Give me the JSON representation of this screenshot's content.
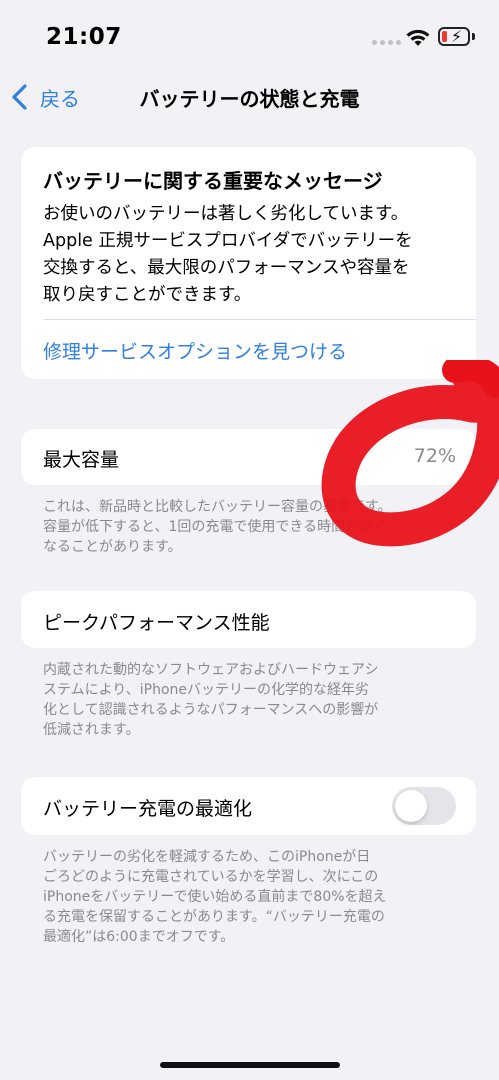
{
  "status_bar": {
    "time": "21:07",
    "battery_level": "low",
    "charging": true,
    "battery_color": "#eb3b30"
  },
  "nav": {
    "back_label": "戻る",
    "title": "バッテリーの状態と充電"
  },
  "message_card": {
    "title": "バッテリーに関する重要なメッセージ",
    "body_lines": [
      "お使いのバッテリーは著しく劣化しています。",
      "Apple 正規サービスプロバイダでバッテリーを",
      "交換すると、最大限のパフォーマンスや容量を",
      "取り戻すことができます。"
    ],
    "link": "修理サービスオプションを見つける"
  },
  "max_capacity": {
    "label": "最大容量",
    "value": "72%",
    "footnote_lines": [
      "これは、新品時と比較したバッテリー容量の基準です。",
      "容量が低下すると、1回の充電で使用できる時間が短く",
      "なることがあります。"
    ]
  },
  "peak_performance": {
    "label": "ピークパフォーマンス性能",
    "footnote_lines": [
      "内蔵された動的なソフトウェアおよびハードウェアシ",
      "ステムにより、iPhoneバッテリーの化学的な経年劣",
      "化として認識されるようなパフォーマンスへの影響が",
      "低減されます。"
    ]
  },
  "optimized_charging": {
    "label": "バッテリー充電の最適化",
    "toggle_on": false,
    "footnote_lines": [
      "バッテリーの劣化を軽減するため、このiPhoneが日",
      "ごろどのように充電されているかを学習し、次にこの",
      "iPhoneをバッテリーで使い始める直前まで80%を超え",
      "る充電を保留することがあります。“バッテリー充電の",
      "最適化”は6:00までオフです。"
    ]
  },
  "colors": {
    "accent": "#2f7fe4",
    "annotation": "#e8121a"
  }
}
